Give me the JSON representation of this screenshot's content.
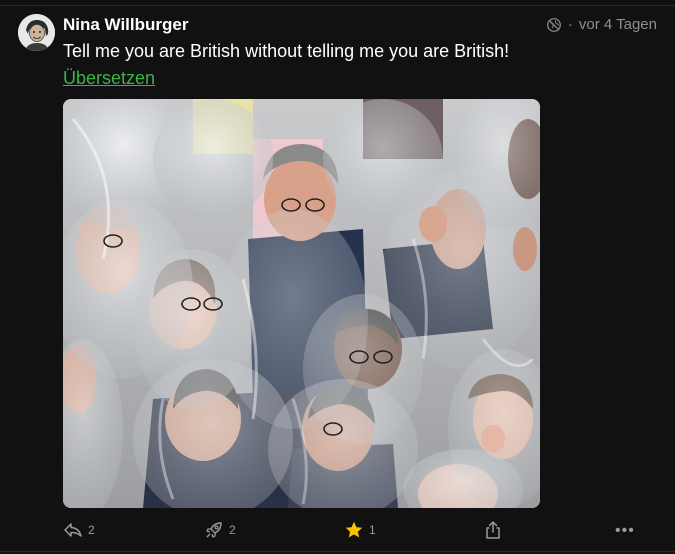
{
  "post": {
    "author": "Nina Willburger",
    "timestamp": "vor 4 Tagen",
    "text": "Tell me you are British without telling me you are British!",
    "translate_label": "Übersetzen",
    "visibility_icon": "globe-off-icon"
  },
  "media": {
    "type": "image",
    "description_icon": "photo"
  },
  "actions": {
    "reply_count": "2",
    "boost_count": "2",
    "favourite_count": "1",
    "favourite_color": "#f5c400",
    "more_label": "•••"
  },
  "colors": {
    "background": "#111111",
    "link": "#39b54a",
    "muted": "#8e8e8e"
  }
}
